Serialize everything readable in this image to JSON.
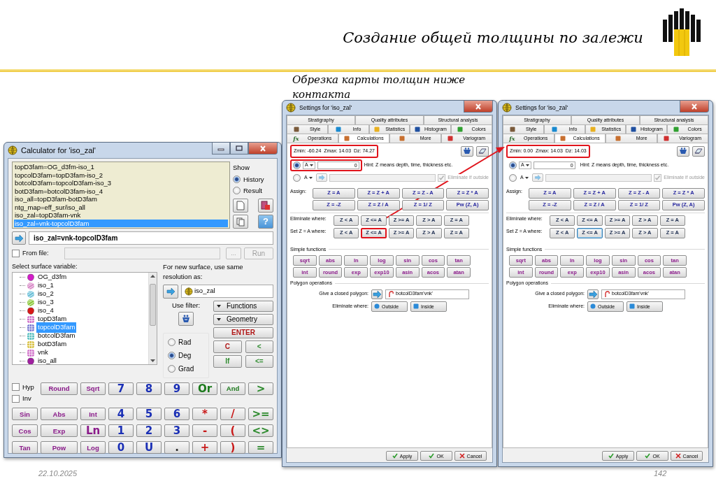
{
  "slide": {
    "title": "Создание общей толщины по залежи",
    "subtitle": "Обрезка карты толщин ниже контакта",
    "date": "22.10.2025",
    "page_number": "142"
  },
  "calculator": {
    "title": "Calculator for 'iso_zal'",
    "history": [
      {
        "text": "topD3fam=OG_d3fm-iso_1",
        "selected": false
      },
      {
        "text": "topcolD3fam=topD3fam-iso_2",
        "selected": false
      },
      {
        "text": "botcolD3fam=topcolD3fam-iso_3",
        "selected": false
      },
      {
        "text": "botD3fam=botcolD3fam-iso_4",
        "selected": false
      },
      {
        "text": "iso_all=topD3fam-botD3fam",
        "selected": false
      },
      {
        "text": "ntg_map=eff_sur/iso_all",
        "selected": false
      },
      {
        "text": "iso_zal=topD3fam-vnk",
        "selected": false
      },
      {
        "text": "iso_zal=vnk-topcolD3fam",
        "selected": true
      }
    ],
    "show_label": "Show",
    "show_options": [
      {
        "label": "History",
        "selected": true
      },
      {
        "label": "Result",
        "selected": false
      }
    ],
    "help_button": "?",
    "expression": "iso_zal=vnk-topcolD3fam",
    "from_file": {
      "label": "From file:",
      "checked": false
    },
    "browse_button": {
      "label": "...",
      "disabled": true
    },
    "run_button": {
      "label": "Run",
      "disabled": true
    },
    "surface_label": "Select surface variable:",
    "surfaces": [
      {
        "name": "OG_d3fm",
        "kind": "blob",
        "color": "#d21ec8",
        "selected": false
      },
      {
        "name": "iso_1",
        "kind": "stripes",
        "color": "#d98cc8",
        "selected": false
      },
      {
        "name": "iso_2",
        "kind": "stripes",
        "color": "#6cc0d8",
        "selected": false
      },
      {
        "name": "iso_3",
        "kind": "stripes",
        "color": "#8cc83c",
        "selected": false
      },
      {
        "name": "iso_4",
        "kind": "blob",
        "color": "#d81818",
        "selected": false
      },
      {
        "name": "topD3fam",
        "kind": "grid",
        "color": "#d070c8",
        "selected": false
      },
      {
        "name": "topcolD3fam",
        "kind": "grid",
        "color": "#7878d0",
        "selected": true
      },
      {
        "name": "botcolD3fam",
        "kind": "grid",
        "color": "#58c0c0",
        "selected": false
      },
      {
        "name": "botD3fam",
        "kind": "grid",
        "color": "#d8c040",
        "selected": false
      },
      {
        "name": "vnk",
        "kind": "grid",
        "color": "#d070c8",
        "selected": false
      },
      {
        "name": "iso_all",
        "kind": "blob",
        "color": "#a020a0",
        "selected": false
      }
    ],
    "resolution_label": "For new surface, use same resolution as:",
    "resolution_value": "iso_zal",
    "filter_label": "Use filter:",
    "menu_buttons": [
      "Functions",
      "Geometry"
    ],
    "angle_options": [
      {
        "label": "Rad",
        "selected": false
      },
      {
        "label": "Deg",
        "selected": true
      },
      {
        "label": "Grad",
        "selected": false
      }
    ],
    "side_keys": [
      {
        "label": "ENTER",
        "color": "#b01818"
      },
      {
        "label": "C",
        "color": "#b01818"
      },
      {
        "label": "<",
        "color": "#2e8b2e"
      },
      {
        "label": "If",
        "color": "#2e8b2e"
      },
      {
        "label": "<=",
        "color": "#2e8b2e"
      }
    ],
    "modifiers": [
      {
        "label": "Hyp",
        "checked": false
      },
      {
        "label": "Inv",
        "checked": false
      }
    ],
    "keys": [
      [
        {
          "label": "Round",
          "color": "#8a1a8a"
        },
        {
          "label": "Sqrt",
          "color": "#8a1a8a"
        },
        {
          "label": "7",
          "color": "#1a2fb5"
        },
        {
          "label": "8",
          "color": "#1a2fb5"
        },
        {
          "label": "9",
          "color": "#1a2fb5"
        },
        {
          "label": "Or",
          "color": "#1d7a1d"
        },
        {
          "label": "And",
          "color": "#1d7a1d"
        },
        {
          "label": ">",
          "color": "#2e8b2e"
        }
      ],
      [
        {
          "label": "Sin",
          "color": "#8a1a8a"
        },
        {
          "label": "Abs",
          "color": "#8a1a8a"
        },
        {
          "label": "Int",
          "color": "#8a1a8a"
        },
        {
          "label": "4",
          "color": "#1a2fb5"
        },
        {
          "label": "5",
          "color": "#1a2fb5"
        },
        {
          "label": "6",
          "color": "#1a2fb5"
        },
        {
          "label": "*",
          "color": "#c81818"
        },
        {
          "label": "/",
          "color": "#c81818"
        },
        {
          "label": ">=",
          "color": "#2e8b2e"
        }
      ],
      [
        {
          "label": "Cos",
          "color": "#8a1a8a"
        },
        {
          "label": "Exp",
          "color": "#8a1a8a"
        },
        {
          "label": "Ln",
          "color": "#8a1a8a"
        },
        {
          "label": "1",
          "color": "#1a2fb5"
        },
        {
          "label": "2",
          "color": "#1a2fb5"
        },
        {
          "label": "3",
          "color": "#1a2fb5"
        },
        {
          "label": "-",
          "color": "#c81818"
        },
        {
          "label": "(",
          "color": "#c81818"
        },
        {
          "label": "<>",
          "color": "#2e8b2e"
        }
      ],
      [
        {
          "label": "Tan",
          "color": "#8a1a8a"
        },
        {
          "label": "Pow",
          "color": "#8a1a8a"
        },
        {
          "label": "Log",
          "color": "#8a1a8a"
        },
        {
          "label": "0",
          "color": "#1a2fb5"
        },
        {
          "label": "U",
          "color": "#1a2fb5"
        },
        {
          "label": ".",
          "color": "#303030"
        },
        {
          "label": "+",
          "color": "#c81818"
        },
        {
          "label": ")",
          "color": "#c81818"
        },
        {
          "label": "=",
          "color": "#2e8b2e"
        }
      ]
    ]
  },
  "settings_windows": [
    {
      "title": "Settings for 'iso_zal'",
      "tab_rows": [
        [
          {
            "label": "Stratigraphy",
            "selected": false
          },
          {
            "label": "Quality attributes",
            "selected": false
          },
          {
            "label": "Structural analysis",
            "selected": false
          }
        ],
        [
          {
            "label": "Style",
            "color": "#7a5a3a",
            "selected": false
          },
          {
            "label": "Info",
            "color": "#1a8ad0",
            "selected": false
          },
          {
            "label": "Statistics",
            "color": "#e8b020",
            "selected": false
          },
          {
            "label": "Histogram",
            "color": "#2050a0",
            "selected": false
          },
          {
            "label": "Colors",
            "color": "#30a030",
            "selected": false
          }
        ],
        [
          {
            "label": "Operations",
            "icon": "fx",
            "selected": false
          },
          {
            "label": "Calculations",
            "color": "#c87030",
            "selected": true
          },
          {
            "label": "More",
            "color": "#c87030",
            "selected": false
          },
          {
            "label": "Variogram",
            "color": "#d03030",
            "selected": false
          }
        ]
      ],
      "stats": {
        "text": "Zmin: -60.24  Zmax: 14.03  Dz: 74.27",
        "highlighted": true
      },
      "operand": {
        "selected": true,
        "dropdown": "A",
        "value": "0",
        "hint": "Hint: Z means depth, time, thickness etc.",
        "highlighted": true
      },
      "operand_2": {
        "selected": false,
        "dropdown": "A",
        "checkbox": {
          "label": "Eliminate if outside",
          "checked": true,
          "disabled": true
        }
      },
      "assign": {
        "label": "Assign:",
        "buttons": [
          "Z = A",
          "Z = Z + A",
          "Z = Z - A",
          "Z = Z * A",
          "Z = -Z",
          "Z = Z / A",
          "Z = 1/ Z",
          "Pw (Z, A)"
        ]
      },
      "eliminate": {
        "label": "Eliminate where:",
        "buttons": [
          "Z < A",
          "Z <= A",
          "Z >= A",
          "Z > A",
          "Z = A"
        ]
      },
      "set_where": {
        "label": "Set Z = A where:",
        "buttons": [
          {
            "label": "Z < A",
            "highlighted": false,
            "focused": false
          },
          {
            "label": "Z <= A",
            "highlighted": true,
            "focused": false
          },
          {
            "label": "Z >= A",
            "highlighted": false,
            "focused": false
          },
          {
            "label": "Z > A",
            "highlighted": false,
            "focused": false
          },
          {
            "label": "Z = A",
            "highlighted": false,
            "focused": false
          }
        ]
      },
      "functions": {
        "label": "Simple functions",
        "buttons": [
          "sqrt",
          "abs",
          "ln",
          "log",
          "sin",
          "cos",
          "tan",
          "int",
          "round",
          "exp",
          "exp10",
          "asin",
          "acos",
          "atan"
        ]
      },
      "polygon": {
        "label": "Polygon operations",
        "give_label": "Give a closed polygon:",
        "value": "botcolD3fam'vnk'",
        "eliminate_label": "Eliminate where:",
        "buttons": [
          {
            "label": "Outside",
            "kind": "circle"
          },
          {
            "label": "Inside",
            "kind": "square"
          }
        ]
      },
      "footer_buttons": [
        {
          "label": "Apply",
          "kind": "check"
        },
        {
          "label": "OK",
          "kind": "check"
        },
        {
          "label": "Cancel",
          "kind": "cross"
        }
      ]
    },
    {
      "title": "Settings for 'iso_zal'",
      "tab_rows": [
        [
          {
            "label": "Stratigraphy",
            "selected": false
          },
          {
            "label": "Quality attributes",
            "selected": false
          },
          {
            "label": "Structural analysis",
            "selected": false
          }
        ],
        [
          {
            "label": "Style",
            "color": "#7a5a3a",
            "selected": false
          },
          {
            "label": "Info",
            "color": "#1a8ad0",
            "selected": false
          },
          {
            "label": "Statistics",
            "color": "#e8b020",
            "selected": false
          },
          {
            "label": "Histogram",
            "color": "#2050a0",
            "selected": false
          },
          {
            "label": "Colors",
            "color": "#30a030",
            "selected": false
          }
        ],
        [
          {
            "label": "Operations",
            "icon": "fx",
            "selected": false
          },
          {
            "label": "Calculations",
            "color": "#c87030",
            "selected": true
          },
          {
            "label": "More",
            "color": "#c87030",
            "selected": false
          },
          {
            "label": "Variogram",
            "color": "#d03030",
            "selected": false
          }
        ]
      ],
      "stats": {
        "text": "Zmin: 0.00  Zmax: 14.03  Dz: 14.03",
        "highlighted": true
      },
      "operand": {
        "selected": true,
        "dropdown": "A",
        "value": "0",
        "hint": "Hint: Z means depth, time, thickness etc.",
        "highlighted": false
      },
      "operand_2": {
        "selected": false,
        "dropdown": "A",
        "checkbox": {
          "label": "Eliminate if outside",
          "checked": true,
          "disabled": true
        }
      },
      "assign": {
        "label": "Assign:",
        "buttons": [
          "Z = A",
          "Z = Z + A",
          "Z = Z - A",
          "Z = Z * A",
          "Z = -Z",
          "Z = Z / A",
          "Z = 1/ Z",
          "Pw (Z, A)"
        ]
      },
      "eliminate": {
        "label": "Eliminate where:",
        "buttons": [
          "Z < A",
          "Z <= A",
          "Z >= A",
          "Z > A",
          "Z = A"
        ]
      },
      "set_where": {
        "label": "Set Z = A where:",
        "buttons": [
          {
            "label": "Z < A",
            "highlighted": false,
            "focused": false
          },
          {
            "label": "Z <= A",
            "highlighted": false,
            "focused": true
          },
          {
            "label": "Z >= A",
            "highlighted": false,
            "focused": false
          },
          {
            "label": "Z > A",
            "highlighted": false,
            "focused": false
          },
          {
            "label": "Z = A",
            "highlighted": false,
            "focused": false
          }
        ]
      },
      "functions": {
        "label": "Simple functions",
        "buttons": [
          "sqrt",
          "abs",
          "ln",
          "log",
          "sin",
          "cos",
          "tan",
          "int",
          "round",
          "exp",
          "exp10",
          "asin",
          "acos",
          "atan"
        ]
      },
      "polygon": {
        "label": "Polygon operations",
        "give_label": "Give a closed polygon:",
        "value": "botcolD3fam'vnk'",
        "eliminate_label": "Eliminate where:",
        "buttons": [
          {
            "label": "Outside",
            "kind": "circle"
          },
          {
            "label": "Inside",
            "kind": "square"
          }
        ]
      },
      "footer_buttons": [
        {
          "label": "Apply",
          "kind": "check"
        },
        {
          "label": "OK",
          "kind": "check"
        },
        {
          "label": "Cancel",
          "kind": "cross"
        }
      ]
    }
  ]
}
